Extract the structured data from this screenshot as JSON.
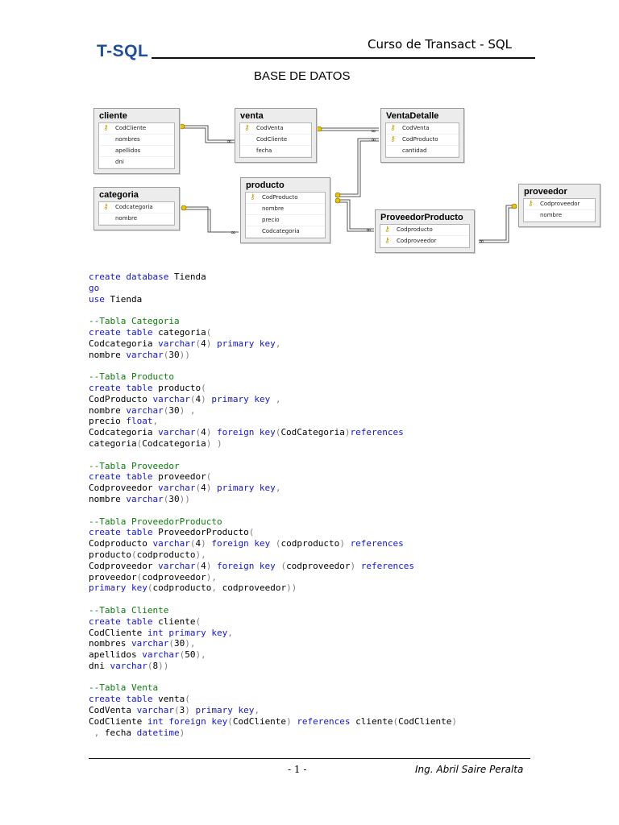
{
  "header": {
    "logo": "T-SQL",
    "course": "Curso de Transact - SQL",
    "title": "BASE DE DATOS"
  },
  "diagram": {
    "tables": {
      "cliente": {
        "name": "cliente",
        "columns": [
          {
            "name": "CodCliente",
            "key": true
          },
          {
            "name": "nombres"
          },
          {
            "name": "apellidos"
          },
          {
            "name": "dni"
          }
        ]
      },
      "venta": {
        "name": "venta",
        "columns": [
          {
            "name": "CodVenta",
            "key": true
          },
          {
            "name": "CodCliente"
          },
          {
            "name": "fecha"
          }
        ]
      },
      "ventadetalle": {
        "name": "VentaDetalle",
        "columns": [
          {
            "name": "CodVenta",
            "key": true
          },
          {
            "name": "CodProducto",
            "key": true
          },
          {
            "name": "cantidad"
          }
        ]
      },
      "categoria": {
        "name": "categoria",
        "columns": [
          {
            "name": "Codcategoria",
            "key": true
          },
          {
            "name": "nombre"
          }
        ]
      },
      "producto": {
        "name": "producto",
        "columns": [
          {
            "name": "CodProducto",
            "key": true
          },
          {
            "name": "nombre"
          },
          {
            "name": "precio"
          },
          {
            "name": "Codcategoria"
          }
        ]
      },
      "proveedorproducto": {
        "name": "ProveedorProducto",
        "columns": [
          {
            "name": "Codproducto",
            "key": true
          },
          {
            "name": "Codproveedor",
            "key": true
          }
        ]
      },
      "proveedor": {
        "name": "proveedor",
        "columns": [
          {
            "name": "Codproveedor",
            "key": true
          },
          {
            "name": "nombre"
          }
        ]
      }
    },
    "key_icon": "key-icon"
  },
  "code": [
    [
      [
        "kw",
        "create database"
      ],
      [
        "t",
        " Tienda"
      ]
    ],
    [
      [
        "kw",
        "go"
      ]
    ],
    [
      [
        "kw",
        "use"
      ],
      [
        "t",
        " Tienda"
      ]
    ],
    [],
    [
      [
        "cm",
        "--Tabla Categoria"
      ]
    ],
    [
      [
        "kw",
        "create table"
      ],
      [
        "t",
        " categoria"
      ],
      [
        "pn",
        "("
      ]
    ],
    [
      [
        "t",
        "Codcategoria "
      ],
      [
        "kw",
        "varchar"
      ],
      [
        "pn",
        "("
      ],
      [
        "t",
        "4"
      ],
      [
        "pn",
        ")"
      ],
      [
        "t",
        " "
      ],
      [
        "kw",
        "primary key"
      ],
      [
        "pn",
        ","
      ]
    ],
    [
      [
        "t",
        "nombre "
      ],
      [
        "kw",
        "varchar"
      ],
      [
        "pn",
        "("
      ],
      [
        "t",
        "30"
      ],
      [
        "pn",
        "))"
      ]
    ],
    [],
    [
      [
        "cm",
        "--Tabla Producto"
      ]
    ],
    [
      [
        "kw",
        "create table"
      ],
      [
        "t",
        " producto"
      ],
      [
        "pn",
        "("
      ]
    ],
    [
      [
        "t",
        "CodProducto "
      ],
      [
        "kw",
        "varchar"
      ],
      [
        "pn",
        "("
      ],
      [
        "t",
        "4"
      ],
      [
        "pn",
        ")"
      ],
      [
        "t",
        " "
      ],
      [
        "kw",
        "primary key"
      ],
      [
        "t",
        " "
      ],
      [
        "pn",
        ","
      ]
    ],
    [
      [
        "t",
        "nombre "
      ],
      [
        "kw",
        "varchar"
      ],
      [
        "pn",
        "("
      ],
      [
        "t",
        "30"
      ],
      [
        "pn",
        ")"
      ],
      [
        "t",
        " "
      ],
      [
        "pn",
        ","
      ]
    ],
    [
      [
        "t",
        "precio "
      ],
      [
        "kw",
        "float"
      ],
      [
        "pn",
        ","
      ]
    ],
    [
      [
        "t",
        "Codcategoria "
      ],
      [
        "kw",
        "varchar"
      ],
      [
        "pn",
        "("
      ],
      [
        "t",
        "4"
      ],
      [
        "pn",
        ")"
      ],
      [
        "t",
        " "
      ],
      [
        "kw",
        "foreign key"
      ],
      [
        "pn",
        "("
      ],
      [
        "t",
        "CodCategoria"
      ],
      [
        "pn",
        ")"
      ],
      [
        "kw",
        "references"
      ]
    ],
    [
      [
        "t",
        "categoria"
      ],
      [
        "pn",
        "("
      ],
      [
        "t",
        "Codcategoria"
      ],
      [
        "pn",
        ")"
      ],
      [
        "t",
        " "
      ],
      [
        "pn",
        ")"
      ]
    ],
    [],
    [
      [
        "cm",
        "--Tabla Proveedor"
      ]
    ],
    [
      [
        "kw",
        "create table"
      ],
      [
        "t",
        " proveedor"
      ],
      [
        "pn",
        "("
      ]
    ],
    [
      [
        "t",
        "Codproveedor "
      ],
      [
        "kw",
        "varchar"
      ],
      [
        "pn",
        "("
      ],
      [
        "t",
        "4"
      ],
      [
        "pn",
        ")"
      ],
      [
        "t",
        " "
      ],
      [
        "kw",
        "primary key"
      ],
      [
        "pn",
        ","
      ]
    ],
    [
      [
        "t",
        "nombre "
      ],
      [
        "kw",
        "varchar"
      ],
      [
        "pn",
        "("
      ],
      [
        "t",
        "30"
      ],
      [
        "pn",
        "))"
      ]
    ],
    [],
    [
      [
        "cm",
        "--Tabla ProveedorProducto"
      ]
    ],
    [
      [
        "kw",
        "create table"
      ],
      [
        "t",
        " ProveedorProducto"
      ],
      [
        "pn",
        "("
      ]
    ],
    [
      [
        "t",
        "Codproducto "
      ],
      [
        "kw",
        "varchar"
      ],
      [
        "pn",
        "("
      ],
      [
        "t",
        "4"
      ],
      [
        "pn",
        ")"
      ],
      [
        "t",
        " "
      ],
      [
        "kw",
        "foreign key"
      ],
      [
        "t",
        " "
      ],
      [
        "pn",
        "("
      ],
      [
        "t",
        "codproducto"
      ],
      [
        "pn",
        ")"
      ],
      [
        "t",
        " "
      ],
      [
        "kw",
        "references"
      ]
    ],
    [
      [
        "t",
        "producto"
      ],
      [
        "pn",
        "("
      ],
      [
        "t",
        "codproducto"
      ],
      [
        "pn",
        "),"
      ]
    ],
    [
      [
        "t",
        "Codproveedor "
      ],
      [
        "kw",
        "varchar"
      ],
      [
        "pn",
        "("
      ],
      [
        "t",
        "4"
      ],
      [
        "pn",
        ")"
      ],
      [
        "t",
        " "
      ],
      [
        "kw",
        "foreign key"
      ],
      [
        "t",
        " "
      ],
      [
        "pn",
        "("
      ],
      [
        "t",
        "codproveedor"
      ],
      [
        "pn",
        ")"
      ],
      [
        "t",
        " "
      ],
      [
        "kw",
        "references"
      ]
    ],
    [
      [
        "t",
        "proveedor"
      ],
      [
        "pn",
        "("
      ],
      [
        "t",
        "codproveedor"
      ],
      [
        "pn",
        "),"
      ]
    ],
    [
      [
        "kw",
        "primary key"
      ],
      [
        "pn",
        "("
      ],
      [
        "t",
        "codproducto"
      ],
      [
        "pn",
        ","
      ],
      [
        "t",
        " codproveedor"
      ],
      [
        "pn",
        "))"
      ]
    ],
    [],
    [
      [
        "cm",
        "--Tabla Cliente"
      ]
    ],
    [
      [
        "kw",
        "create table"
      ],
      [
        "t",
        " cliente"
      ],
      [
        "pn",
        "("
      ]
    ],
    [
      [
        "t",
        "CodCliente "
      ],
      [
        "kw",
        "int primary key"
      ],
      [
        "pn",
        ","
      ]
    ],
    [
      [
        "t",
        "nombres "
      ],
      [
        "kw",
        "varchar"
      ],
      [
        "pn",
        "("
      ],
      [
        "t",
        "30"
      ],
      [
        "pn",
        "),"
      ]
    ],
    [
      [
        "t",
        "apellidos "
      ],
      [
        "kw",
        "varchar"
      ],
      [
        "pn",
        "("
      ],
      [
        "t",
        "50"
      ],
      [
        "pn",
        "),"
      ]
    ],
    [
      [
        "t",
        "dni "
      ],
      [
        "kw",
        "varchar"
      ],
      [
        "pn",
        "("
      ],
      [
        "t",
        "8"
      ],
      [
        "pn",
        "))"
      ]
    ],
    [],
    [
      [
        "cm",
        "--Tabla Venta"
      ]
    ],
    [
      [
        "kw",
        "create table"
      ],
      [
        "t",
        " venta"
      ],
      [
        "pn",
        "("
      ]
    ],
    [
      [
        "t",
        "CodVenta "
      ],
      [
        "kw",
        "varchar"
      ],
      [
        "pn",
        "("
      ],
      [
        "t",
        "3"
      ],
      [
        "pn",
        ")"
      ],
      [
        "t",
        " "
      ],
      [
        "kw",
        "primary key"
      ],
      [
        "pn",
        ","
      ]
    ],
    [
      [
        "t",
        "CodCliente "
      ],
      [
        "kw",
        "int foreign key"
      ],
      [
        "pn",
        "("
      ],
      [
        "t",
        "CodCliente"
      ],
      [
        "pn",
        ")"
      ],
      [
        "t",
        " "
      ],
      [
        "kw",
        "references"
      ],
      [
        "t",
        " cliente"
      ],
      [
        "pn",
        "("
      ],
      [
        "t",
        "CodCliente"
      ],
      [
        "pn",
        ")"
      ]
    ],
    [
      [
        "t",
        " "
      ],
      [
        "pn",
        ","
      ],
      [
        "t",
        " fecha "
      ],
      [
        "kw",
        "datetime"
      ],
      [
        "pn",
        ")"
      ]
    ]
  ],
  "footer": {
    "page": "- 1 -",
    "author": "Ing. Abril Saire Peralta"
  }
}
